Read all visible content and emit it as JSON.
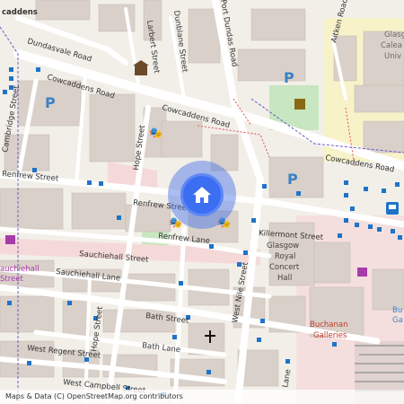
{
  "map": {
    "attribution": "Maps & Data (C) OpenStreetMap.org contributors",
    "colors": {
      "background": "#f2efe9",
      "building": "#d9d0c9",
      "road": "#ffffff",
      "pedestrian": "#f5d9d9",
      "park": "#c8e6c0",
      "university": "#f7f2c8",
      "parking": "#3b82c4",
      "marker": "#3b6ef0",
      "railway": "#555555"
    },
    "streets": {
      "top_left_fragment": "caddens",
      "dundasvale": "Dundasvale Road",
      "cowcaddens_west": "Cowcaddens Road",
      "cowcaddens_mid": "Cowcaddens Road",
      "cowcaddens_east": "Cowcaddens Road",
      "larbert": "Larbert Street",
      "dunblane": "Dunblane Street",
      "port_dundas": "Port Dundas Road",
      "aitken": "Aitken Road",
      "cambridge": "Cambridge Street",
      "hope_north": "Hope Street",
      "renfrew_west": "Renfrew Street",
      "renfrew_mid": "Renfrew Street",
      "renfrew_lane": "Renfrew Lane",
      "killermont": "Killermont Street",
      "sauchiehall": "Sauchiehall Street",
      "sauchiehall_lane": "Sauchiehall Lane",
      "west_nile": "West Nile Street",
      "bath": "Bath Street",
      "bath_lane": "Bath Lane",
      "west_regent": "West Regent Street",
      "hope_south": "Hope Street",
      "west_campbell": "West Campbell Street",
      "bottom_fragment": "Lane"
    },
    "places": {
      "glasgow_uni": "Glasg\nCalea\nUniv",
      "concert_hall": "Glasgow\nRoyal\nConcert\nHall",
      "sauchiehall_poi": "Sauchiehall\nStreet",
      "buchanan_galleries": "Buchanan\nGalleries",
      "buchanan_station_fragment": "Bu\nGa"
    },
    "icons": {
      "home": "home-icon",
      "parking": "parking-icon",
      "theatre": "theatre-icon",
      "museum": "museum-icon",
      "shop": "shopping-bag-icon",
      "church": "church-cross-icon",
      "bus": "bus-icon"
    }
  }
}
